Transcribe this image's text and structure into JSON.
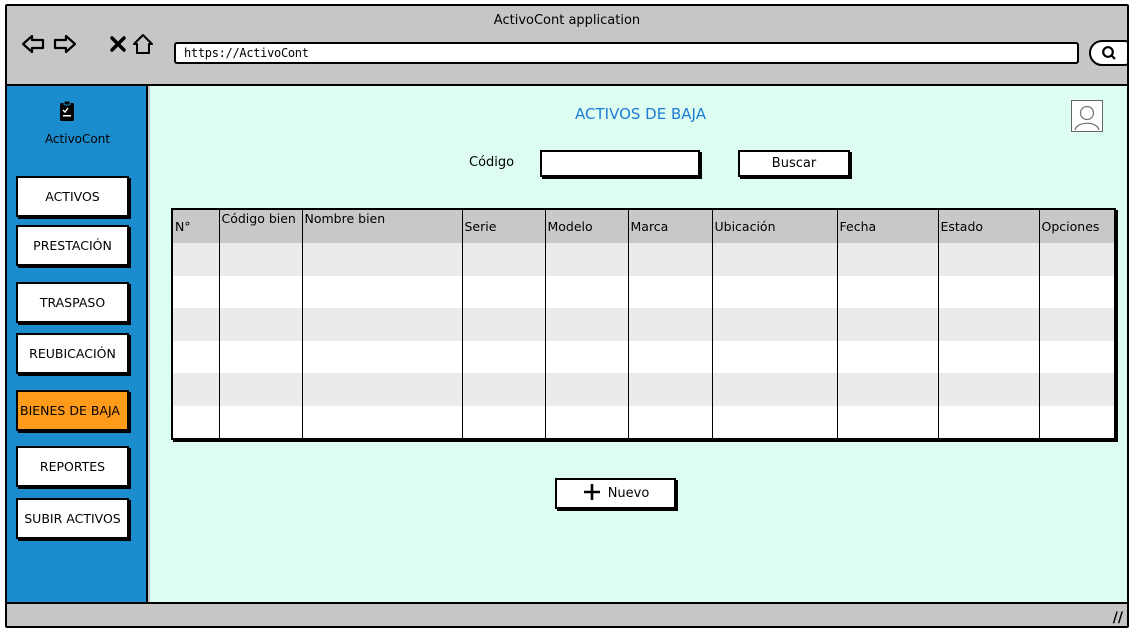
{
  "window": {
    "title": "ActivoCont application"
  },
  "browser": {
    "url": "https://ActivoCont"
  },
  "sidebar": {
    "brand": "ActivoCont",
    "items": [
      {
        "label": "ACTIVOS",
        "active": false
      },
      {
        "label": "PRESTACIÓN",
        "active": false
      },
      {
        "label": "TRASPASO",
        "active": false
      },
      {
        "label": "REUBICACIÓN",
        "active": false
      },
      {
        "label": "BIENES DE BAJA",
        "active": true
      },
      {
        "label": "REPORTES",
        "active": false
      },
      {
        "label": "SUBIR ACTIVOS",
        "active": false
      }
    ]
  },
  "main": {
    "title": "ACTIVOS DE BAJA",
    "codigo_label": "Código",
    "search_button": "Buscar",
    "table": {
      "headers": [
        "N°",
        "Código bien",
        "Nombre bien",
        "Serie",
        "Modelo",
        "Marca",
        "Ubicación",
        "Fecha",
        "Estado",
        "Opciones"
      ]
    },
    "new_button": "Nuevo"
  },
  "colors": {
    "sidebar": "#1b8ccd",
    "content_bg": "#dcfdef",
    "active_item": "#ff9b1a",
    "title": "#1e7bd8"
  },
  "icons": [
    "back-arrow-icon",
    "forward-arrow-icon",
    "close-x-icon",
    "home-icon",
    "search-icon",
    "clipboard-icon",
    "avatar-icon",
    "plus-icon",
    "resize-grip-icon"
  ]
}
